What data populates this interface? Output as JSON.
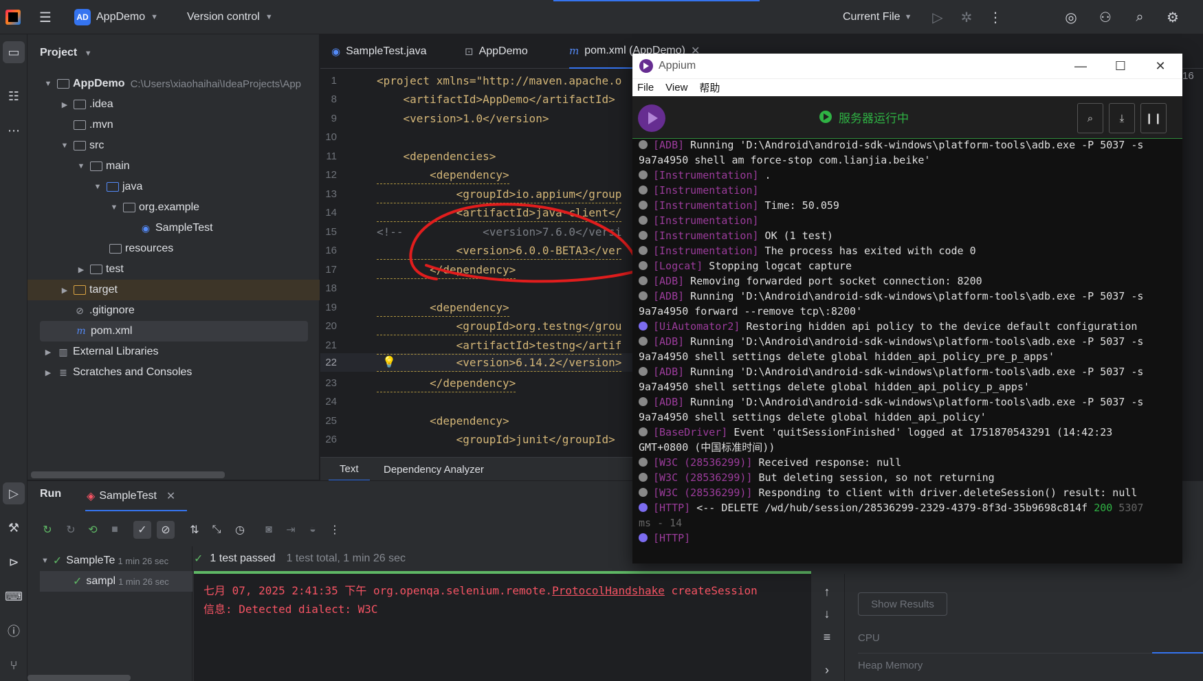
{
  "titlebar": {
    "project_badge": "AD",
    "project_name": "AppDemo",
    "vcs": "Version control",
    "run_config": "Current File"
  },
  "project_pane": {
    "header": "Project",
    "items": [
      {
        "label": "AppDemo",
        "hint": "C:\\Users\\xiaohaihai\\IdeaProjects\\App"
      },
      {
        "label": ".idea"
      },
      {
        "label": ".mvn"
      },
      {
        "label": "src"
      },
      {
        "label": "main"
      },
      {
        "label": "java"
      },
      {
        "label": "org.example"
      },
      {
        "label": "SampleTest"
      },
      {
        "label": "resources"
      },
      {
        "label": "test"
      },
      {
        "label": "target"
      },
      {
        "label": ".gitignore"
      },
      {
        "label": "pom.xml"
      },
      {
        "label": "External Libraries"
      },
      {
        "label": "Scratches and Consoles"
      }
    ]
  },
  "editor": {
    "tabs": [
      "SampleTest.java",
      "AppDemo",
      "pom.xml (AppDemo)"
    ],
    "right_num": "16",
    "lines": [
      {
        "n": "1",
        "text": "<project xmlns=\"http://maven.apache.o"
      },
      {
        "n": "8",
        "text": "    <artifactId>AppDemo</artifactId>"
      },
      {
        "n": "9",
        "text": "    <version>1.0</version>"
      },
      {
        "n": "10",
        "text": ""
      },
      {
        "n": "11",
        "text": "    <dependencies>"
      },
      {
        "n": "12",
        "text": "        <dependency>"
      },
      {
        "n": "13",
        "text": "            <groupId>io.appium</group"
      },
      {
        "n": "14",
        "text": "            <artifactId>java-client</"
      },
      {
        "n": "15",
        "text": "<!--            <version>7.6.0</versi"
      },
      {
        "n": "16",
        "text": "            <version>6.0.0-BETA3</ver"
      },
      {
        "n": "17",
        "text": "        </dependency>"
      },
      {
        "n": "18",
        "text": ""
      },
      {
        "n": "19",
        "text": "        <dependency>"
      },
      {
        "n": "20",
        "text": "            <groupId>org.testng</grou"
      },
      {
        "n": "21",
        "text": "            <artifactId>testng</artif"
      },
      {
        "n": "22",
        "text": "            <version>6.14.2</version>"
      },
      {
        "n": "23",
        "text": "        </dependency>"
      },
      {
        "n": "24",
        "text": ""
      },
      {
        "n": "25",
        "text": "        <dependency>"
      },
      {
        "n": "26",
        "text": "            <groupId>junit</groupId>"
      }
    ],
    "bottom_tabs": [
      "Text",
      "Dependency Analyzer"
    ]
  },
  "run": {
    "title": "Run",
    "tab": "SampleTest",
    "tree": [
      {
        "label": "SampleTe",
        "time": "1 min 26 sec"
      },
      {
        "label": "sampl",
        "time": "1 min 26 sec"
      }
    ],
    "status": "1 test passed",
    "status_sub": "1 test total, 1 min 26 sec",
    "console": [
      "七月 07, 2025 2:41:35 下午 org.openqa.selenium.remote.",
      "ProtocolHandshake",
      " createSession",
      "信息: Detected dialect: W3C"
    ],
    "show_results": "Show Results",
    "cpu": "CPU",
    "heap": "Heap Memory"
  },
  "appium": {
    "title": "Appium",
    "menu": [
      "File",
      "View",
      "帮助"
    ],
    "status": "服务器运行中",
    "log": [
      {
        "dot": "n",
        "tag": "[ADB]",
        "text": " Running 'D:\\Android\\android-sdk-windows\\platform-tools\\adb.exe -P 5037 -s"
      },
      {
        "dot": "",
        "tag": "",
        "text": "9a7a4950 shell am force-stop com.lianjia.beike'"
      },
      {
        "dot": "n",
        "tag": "[Instrumentation]",
        "text": " ."
      },
      {
        "dot": "n",
        "tag": "[Instrumentation]",
        "text": ""
      },
      {
        "dot": "n",
        "tag": "[Instrumentation]",
        "text": " Time: 50.059"
      },
      {
        "dot": "n",
        "tag": "[Instrumentation]",
        "text": ""
      },
      {
        "dot": "n",
        "tag": "[Instrumentation]",
        "text": " OK (1 test)"
      },
      {
        "dot": "n",
        "tag": "[Instrumentation]",
        "text": " The process has exited with code 0"
      },
      {
        "dot": "n",
        "tag": "[Logcat]",
        "text": " Stopping logcat capture"
      },
      {
        "dot": "n",
        "tag": "[ADB]",
        "text": " Removing forwarded port socket connection: 8200"
      },
      {
        "dot": "n",
        "tag": "[ADB]",
        "text": " Running 'D:\\Android\\android-sdk-windows\\platform-tools\\adb.exe -P 5037 -s"
      },
      {
        "dot": "",
        "tag": "",
        "text": "9a7a4950 forward --remove tcp\\:8200'"
      },
      {
        "dot": "i",
        "tag": "[UiAutomator2]",
        "text": " Restoring hidden api policy to the device default configuration"
      },
      {
        "dot": "n",
        "tag": "[ADB]",
        "text": " Running 'D:\\Android\\android-sdk-windows\\platform-tools\\adb.exe -P 5037 -s"
      },
      {
        "dot": "",
        "tag": "",
        "text": "9a7a4950 shell settings delete global hidden_api_policy_pre_p_apps'"
      },
      {
        "dot": "n",
        "tag": "[ADB]",
        "text": " Running 'D:\\Android\\android-sdk-windows\\platform-tools\\adb.exe -P 5037 -s"
      },
      {
        "dot": "",
        "tag": "",
        "text": "9a7a4950 shell settings delete global hidden_api_policy_p_apps'"
      },
      {
        "dot": "n",
        "tag": "[ADB]",
        "text": " Running 'D:\\Android\\android-sdk-windows\\platform-tools\\adb.exe -P 5037 -s"
      },
      {
        "dot": "",
        "tag": "",
        "text": "9a7a4950 shell settings delete global hidden_api_policy'"
      },
      {
        "dot": "n",
        "tag": "[BaseDriver]",
        "text": " Event 'quitSessionFinished' logged at 1751870543291 (14:42:23"
      },
      {
        "dot": "",
        "tag": "",
        "text": "GMT+0800 (中国标准时间))"
      },
      {
        "dot": "n",
        "tag": "[W3C (28536299)]",
        "text": " Received response: null"
      },
      {
        "dot": "n",
        "tag": "[W3C (28536299)]",
        "text": " But deleting session, so not returning"
      },
      {
        "dot": "n",
        "tag": "[W3C (28536299)]",
        "text": " Responding to client with driver.deleteSession() result: null"
      },
      {
        "dot": "i",
        "tag": "[HTTP]",
        "text": " <-- DELETE /wd/hub/session/28536299-2329-4379-8f3d-35b9698c814f ",
        "green": "200",
        "muted": " 5307"
      },
      {
        "dot": "",
        "tag": "",
        "text": "",
        "muted_only": "ms - 14"
      },
      {
        "dot": "i",
        "tag": "[HTTP]",
        "text": ""
      }
    ]
  }
}
